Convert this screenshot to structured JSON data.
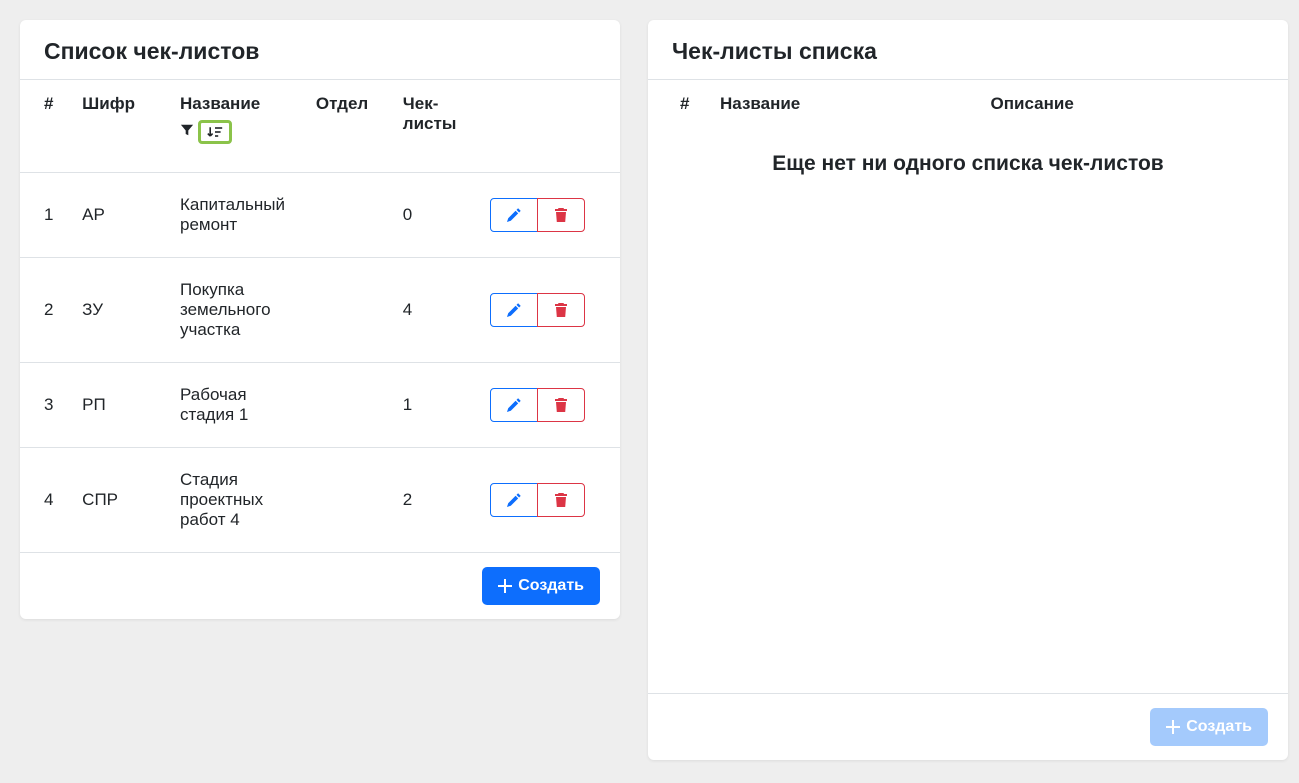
{
  "left": {
    "title": "Список чек-листов",
    "headers": {
      "num": "#",
      "code": "Шифр",
      "name": "Название",
      "dept": "Отдел",
      "count": "Чек-листы"
    },
    "rows": [
      {
        "num": "1",
        "code": "АР",
        "name": "Капитальный ремонт",
        "dept": "",
        "count": "0"
      },
      {
        "num": "2",
        "code": "ЗУ",
        "name": "Покупка земельного участка",
        "dept": "",
        "count": "4"
      },
      {
        "num": "3",
        "code": "РП",
        "name": "Рабочая стадия 1",
        "dept": "",
        "count": "1"
      },
      {
        "num": "4",
        "code": "СПР",
        "name": "Стадия проектных работ 4",
        "dept": "",
        "count": "2"
      }
    ],
    "create_label": "Создать"
  },
  "right": {
    "title": "Чек-листы списка",
    "headers": {
      "num": "#",
      "name": "Название",
      "desc": "Описание"
    },
    "empty": "Еще нет ни одного списка чек-листов",
    "create_label": "Создать"
  }
}
